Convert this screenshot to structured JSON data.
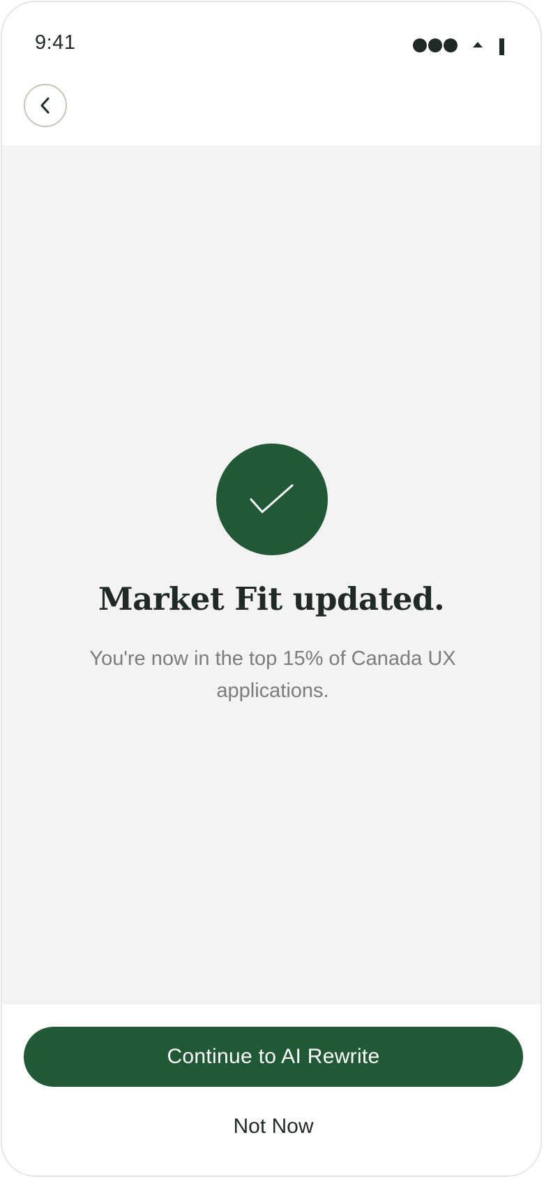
{
  "status_bar": {
    "time": "9:41"
  },
  "header": {
    "back_icon": "chevron-left-icon"
  },
  "success": {
    "icon": "checkmark-icon",
    "title": "Market Fit updated.",
    "subtitle": "You're now in the top 15% of Canada UX applications."
  },
  "actions": {
    "primary_label": "Continue to AI Rewrite",
    "secondary_label": "Not Now"
  },
  "colors": {
    "accent": "#215937",
    "background": "#f3f3f3",
    "text_primary": "#1f2a26",
    "text_secondary": "#7a7d7b",
    "back_border": "#c9c4b3"
  }
}
